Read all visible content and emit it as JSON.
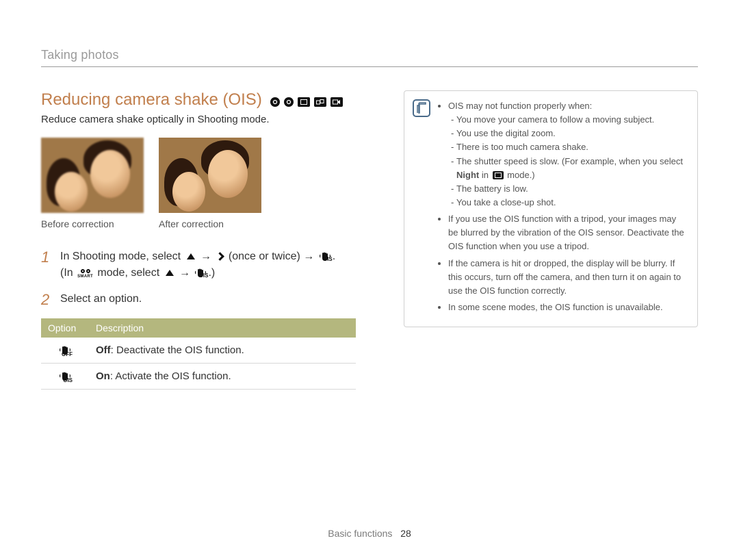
{
  "breadcrumb": "Taking photos",
  "heading": "Reducing camera shake (OIS)",
  "subtext": "Reduce camera shake optically in Shooting mode.",
  "img_captions": {
    "before": "Before correction",
    "after": "After correction"
  },
  "steps": {
    "s1_a": "In Shooting mode, select ",
    "s1_b": " (once or twice) ",
    "s1_c": "(In ",
    "s1_d": " mode, select ",
    "s1_e": ".)",
    "s2": "Select an option."
  },
  "arrow": "→",
  "period": ".",
  "smart_label": "SMART",
  "ois_sub": "OIS",
  "off_sub": "OFF",
  "table": {
    "h1": "Option",
    "h2": "Description",
    "r1_bold": "Off",
    "r1_rest": ": Deactivate the OIS function.",
    "r2_bold": "On",
    "r2_rest": ": Activate the OIS function."
  },
  "note": {
    "b1": "OIS may not function properly when:",
    "b1_1": "You move your camera to follow a moving subject.",
    "b1_2": "You use the digital zoom.",
    "b1_3": "There is too much camera shake.",
    "b1_4a": "The shutter speed is slow. (For example, when you select ",
    "b1_4_bold": "Night",
    "b1_4b": " in ",
    "b1_4c": " mode.)",
    "b1_5": "The battery is low.",
    "b1_6": "You take a close-up shot.",
    "b2": "If you use the OIS function with a tripod, your images may be blurred by the vibration of the OIS sensor. Deactivate the OIS function when you use a tripod.",
    "b3": "If the camera is hit or dropped, the display will be blurry. If this occurs, turn off the camera, and then turn it on again to use the OIS function correctly.",
    "b4": "In some scene modes, the OIS function is unavailable."
  },
  "footer": {
    "section": "Basic functions",
    "page": "28"
  }
}
